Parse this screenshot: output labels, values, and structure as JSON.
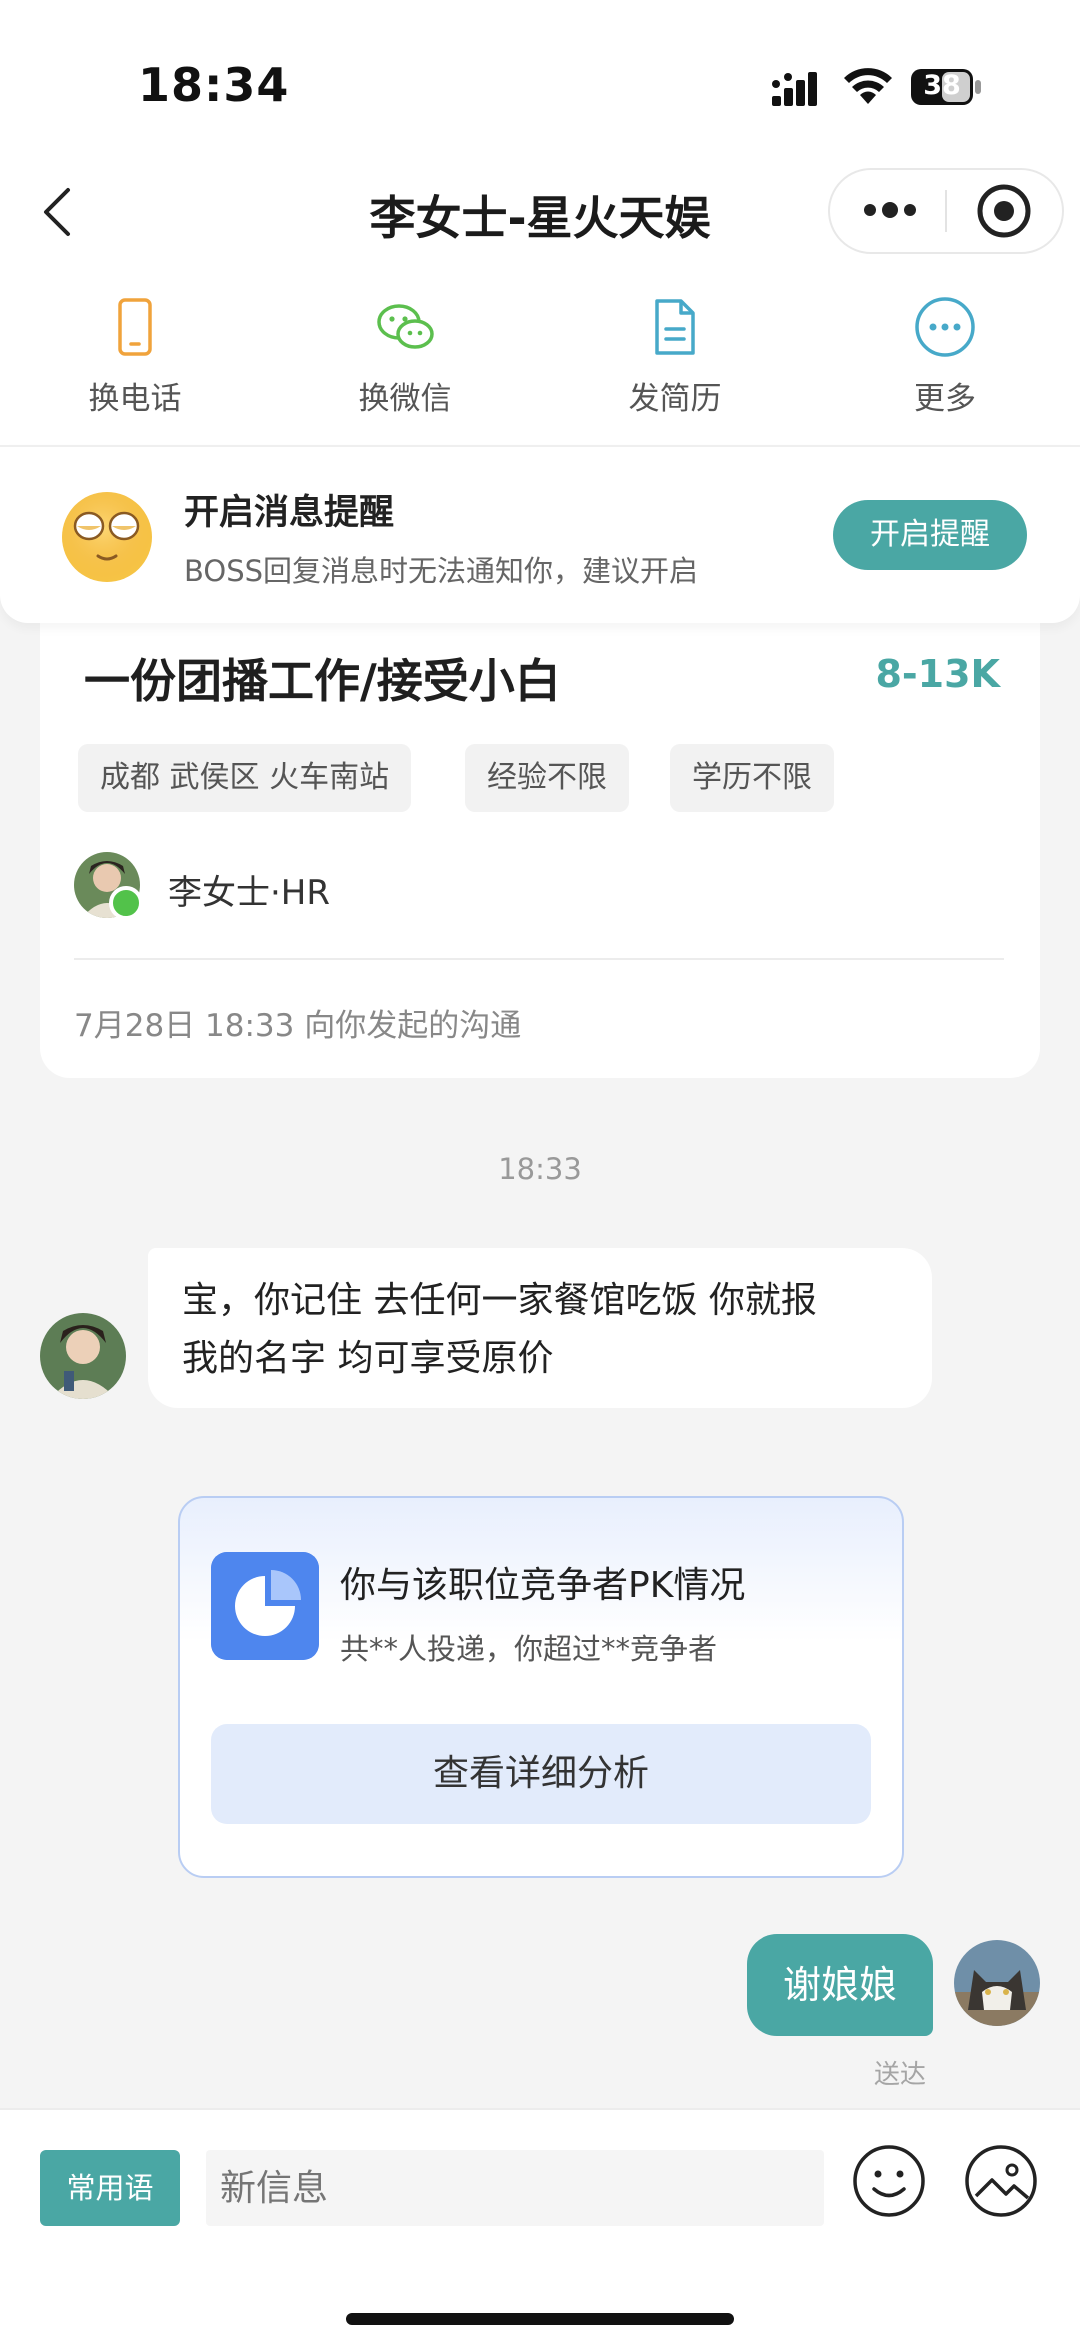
{
  "status_bar": {
    "time": "18:34",
    "battery": "38"
  },
  "nav": {
    "title": "李女士-星火天娱"
  },
  "actions": [
    {
      "label": "换电话",
      "icon": "phone-icon"
    },
    {
      "label": "换微信",
      "icon": "wechat-icon"
    },
    {
      "label": "发简历",
      "icon": "resume-icon"
    },
    {
      "label": "更多",
      "icon": "more-icon"
    }
  ],
  "reminder": {
    "title": "开启消息提醒",
    "subtitle": "BOSS回复消息时无法通知你，建议开启",
    "button": "开启提醒"
  },
  "job": {
    "title": "一份团播工作/接受小白",
    "salary": "8-13K",
    "tags": [
      "成都 武侯区 火车南站",
      "经验不限",
      "学历不限"
    ],
    "hr_name": "李女士·HR",
    "meta": "7月28日 18:33 向你发起的沟通"
  },
  "chat": {
    "timestamp": "18:33",
    "recruiter_message_line1": "宝，你记住 去任何一家餐馆吃饭 你就报",
    "recruiter_message_line2": "我的名字 均可享受原价",
    "pk_card": {
      "title": "你与该职位竞争者PK情况",
      "subtitle": "共**人投递，你超过**竞争者",
      "button": "查看详细分析"
    },
    "my_message": "谢娘娘",
    "status": "送达"
  },
  "input": {
    "quick_phrases": "常用语",
    "placeholder": "新信息"
  },
  "colors": {
    "accent": "#4aa7a4",
    "pk_blue": "#4e86ee",
    "online": "#52c24a"
  }
}
